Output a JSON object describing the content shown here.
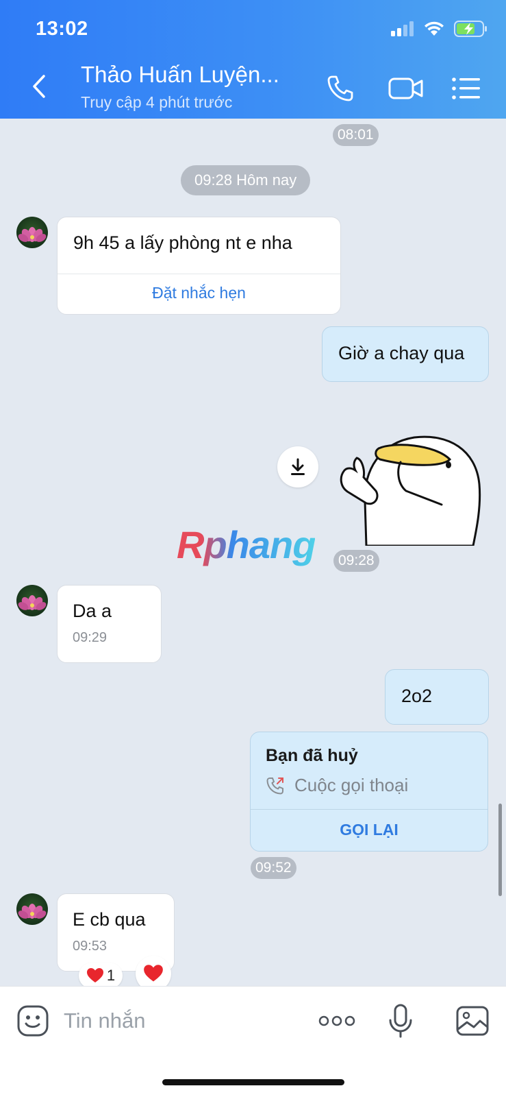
{
  "status_bar": {
    "time": "13:02"
  },
  "header": {
    "title": "Thảo Huấn Luyện...",
    "subtitle": "Truy cập 4 phút trước",
    "back_icon": "chevron-left-icon",
    "call_icon": "phone-icon",
    "video_icon": "video-camera-icon",
    "menu_icon": "list-menu-icon"
  },
  "chat": {
    "top_time": "08:01",
    "date_separator": "09:28 Hôm nay",
    "messages": [
      {
        "from": "contact",
        "text": "9h 45 a lấy phòng nt e nha",
        "action": "Đặt nhắc hẹn"
      },
      {
        "from": "me",
        "text": "Giờ a chay qua"
      },
      {
        "from": "me",
        "type": "sticker",
        "time": "09:28"
      },
      {
        "from": "contact",
        "text": "Da a",
        "time": "09:29"
      },
      {
        "from": "me",
        "text": "2o2"
      },
      {
        "from": "me",
        "type": "call",
        "title": "Bạn đã huỷ",
        "call_label": "Cuộc gọi thoại",
        "action": "GỌI LẠI",
        "time": "09:52"
      },
      {
        "from": "contact",
        "text": "E cb qua",
        "time": "09:53",
        "reaction_count": "1"
      }
    ],
    "watermark": "Rphang"
  },
  "composer": {
    "placeholder": "Tin nhắn",
    "emoji_icon": "sticker-face-icon",
    "more_icon": "more-dots-icon",
    "mic_icon": "microphone-icon",
    "image_icon": "image-icon"
  },
  "colors": {
    "header_start": "#2f7cf6",
    "header_end": "#4fa6f0",
    "chat_bg": "#e3e9f1",
    "outgoing_bubble": "#d6ecfb",
    "link": "#2f7be0"
  }
}
